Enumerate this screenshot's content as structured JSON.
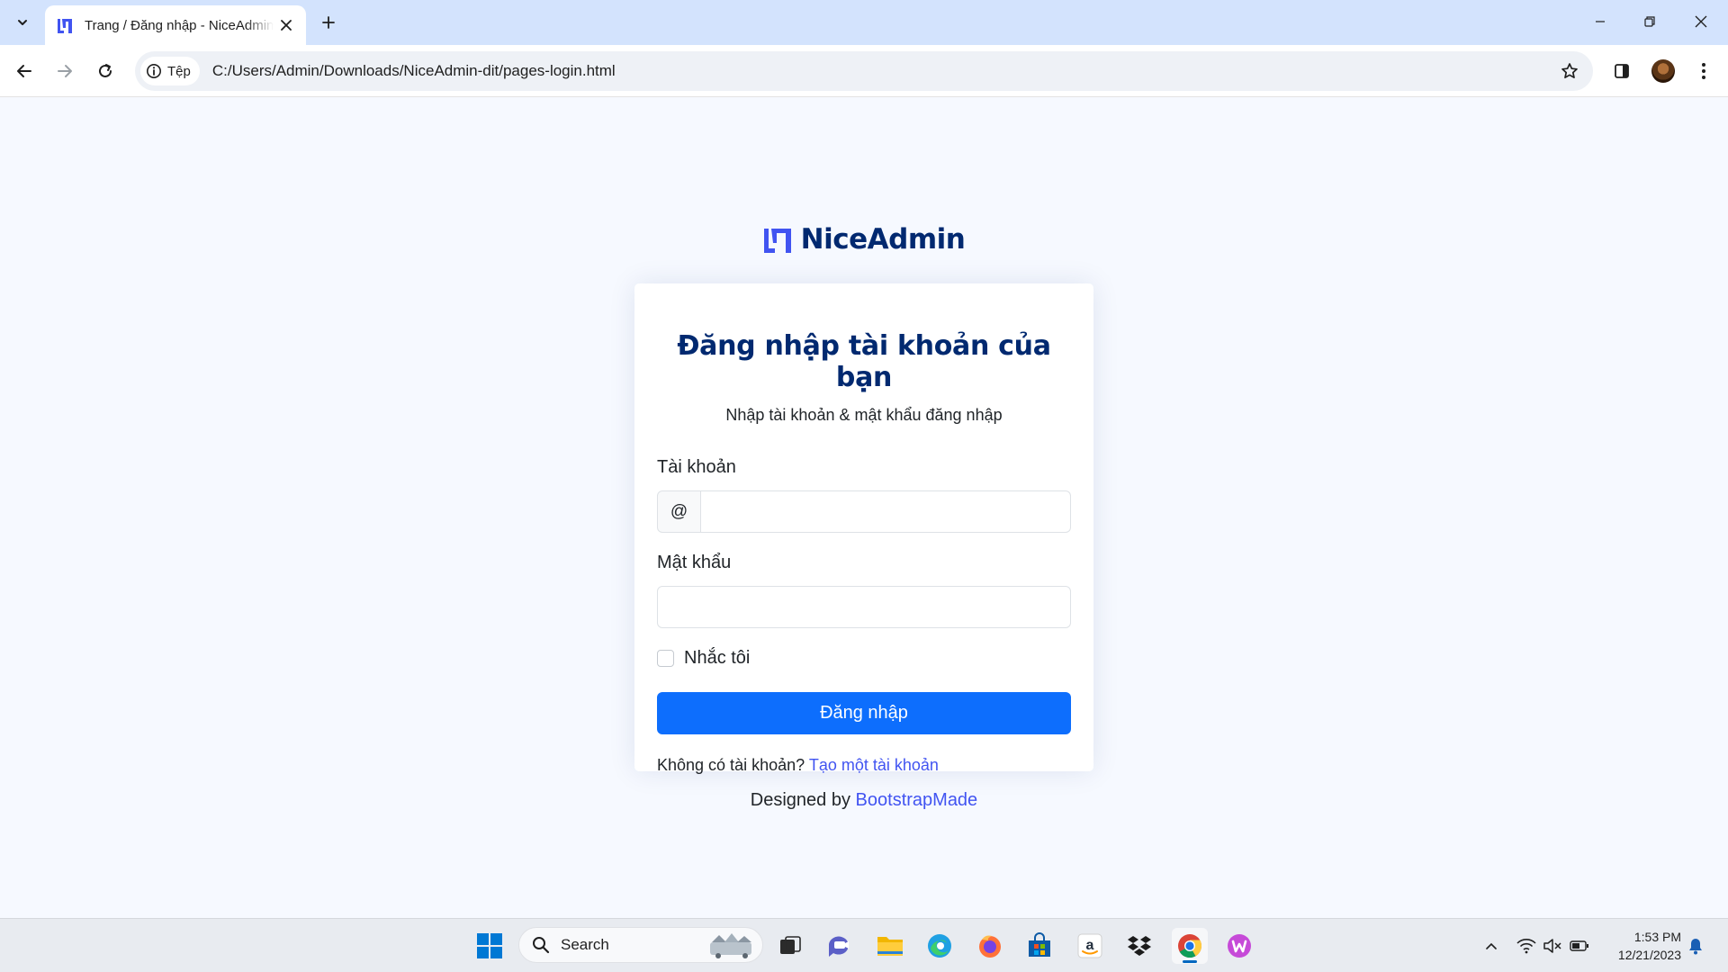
{
  "browser": {
    "tab_title": "Trang / Đăng nhập - NiceAdmin",
    "site_chip": "Tệp",
    "url": "C:/Users/Admin/Downloads/NiceAdmin-dit/pages-login.html"
  },
  "page": {
    "logo_text": "NiceAdmin",
    "title": "Đăng nhập tài khoản của bạn",
    "subtitle": "Nhập tài khoản & mật khẩu đăng nhập",
    "username_label": "Tài khoản",
    "username_prefix": "@",
    "username_value": "",
    "password_label": "Mật khẩu",
    "password_value": "",
    "remember_label": "Nhắc tôi",
    "remember_checked": false,
    "login_button": "Đăng nhập",
    "no_account_text": "Không có tài khoản?",
    "create_account_link": "Tạo một tài khoản",
    "credits_prefix": "Designed by",
    "credits_link": "BootstrapMade"
  },
  "taskbar": {
    "search_label": "Search",
    "time": "1:53 PM",
    "date": "12/21/2023",
    "apps": [
      "start-icon",
      "task-view-icon",
      "teams-chat-icon",
      "file-explorer-icon",
      "edge-icon",
      "firefox-icon",
      "microsoft-store-icon",
      "amazon-icon",
      "dropbox-icon",
      "chrome-icon",
      "wps-office-icon"
    ]
  },
  "colors": {
    "brand_navy": "#012970",
    "link_blue": "#4154f1",
    "primary_button": "#0d6efd",
    "page_background": "#f6f9ff",
    "tabbar": "#d3e3fd"
  }
}
